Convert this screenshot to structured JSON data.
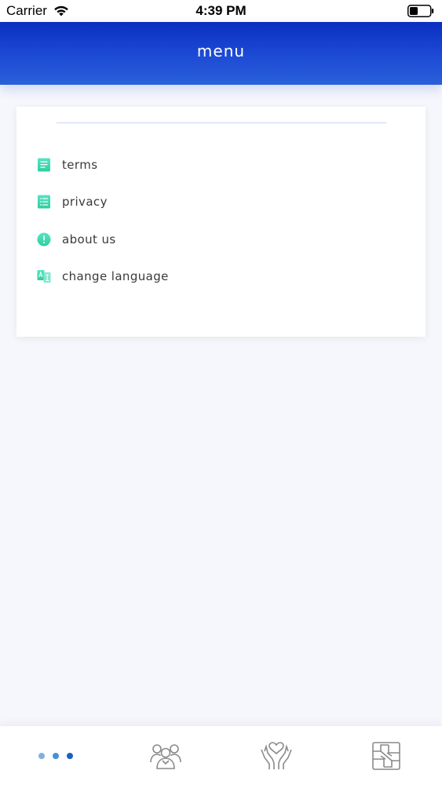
{
  "status_bar": {
    "carrier": "Carrier",
    "time": "4:39 PM"
  },
  "header": {
    "title": "menu"
  },
  "menu": {
    "items": [
      {
        "label": "terms",
        "icon": "document-icon"
      },
      {
        "label": "privacy",
        "icon": "list-icon"
      },
      {
        "label": "about us",
        "icon": "info-icon"
      },
      {
        "label": "change language",
        "icon": "translate-icon"
      }
    ]
  },
  "tab_bar": {
    "tabs": [
      {
        "icon": "more-dots-icon"
      },
      {
        "icon": "people-group-icon"
      },
      {
        "icon": "hands-heart-icon"
      },
      {
        "icon": "joined-hands-icon"
      }
    ]
  },
  "colors": {
    "header_top": "#0a2fc0",
    "header_bottom": "#2a60d8",
    "icon_teal": "#3ddbb3",
    "text": "#3a3a3a",
    "background": "#f6f7fc",
    "dot_light": "#7fb0e0",
    "dot_mid": "#4a8ed6",
    "dot_dark": "#1c5fc4"
  }
}
